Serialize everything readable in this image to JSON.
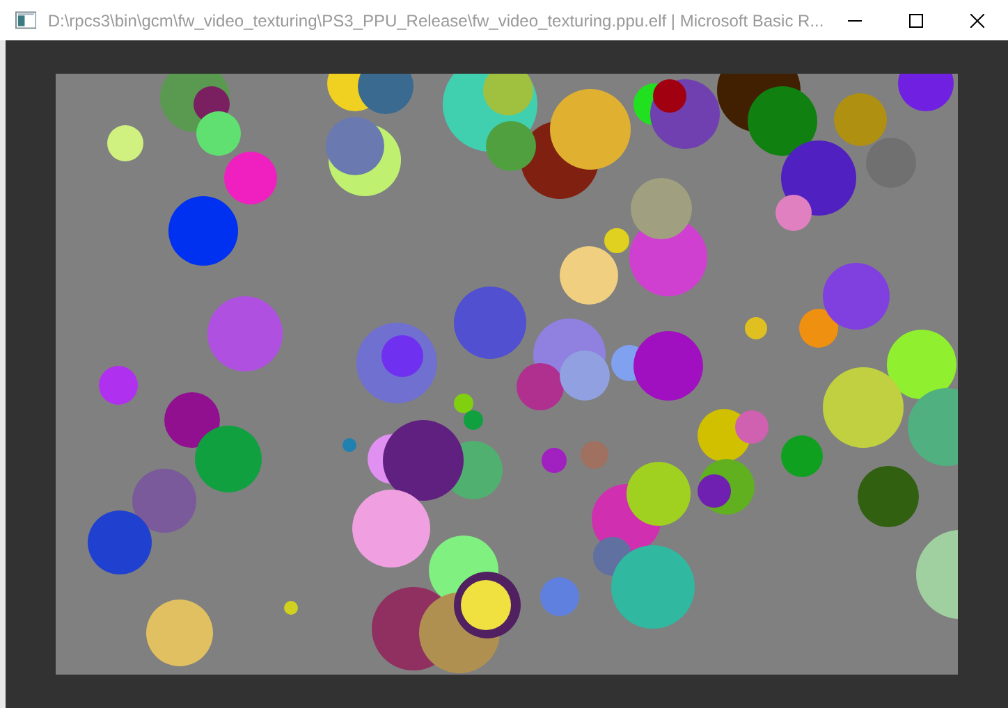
{
  "window": {
    "title": "D:\\rpcs3\\bin\\gcm\\fw_video_texturing\\PS3_PPU_Release\\fw_video_texturing.ppu.elf | Microsoft Basic R..."
  }
}
